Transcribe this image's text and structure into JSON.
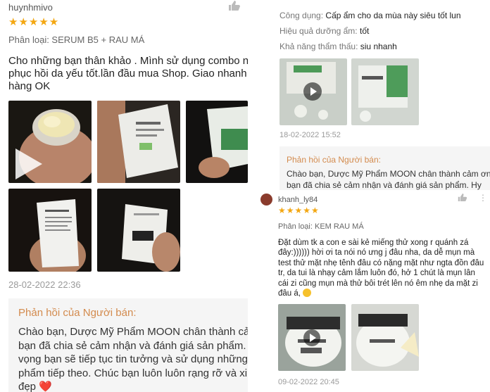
{
  "left_review": {
    "username": "huynhmivo",
    "stars": "★★★★★",
    "classification": "Phân loại: SERUM B5 + RAU MÁ",
    "comment_lines": [
      "Cho những bạn thân khảo . Mình sử dụng combo này",
      "phục hồi da yếu tốt.lần đầu mua Shop. Giao nhanh gọ",
      "hàng OK"
    ],
    "date": "28-02-2022 22:36",
    "seller_reply": {
      "title": "Phản hồi của Người bán:",
      "lines": [
        "Chào bạn, Dược Mỹ Phẩm MOON chân thành cảm ơ",
        "bạn đã chia sẻ cảm nhận và đánh giá sản phẩm. Hy",
        "vọng bạn sẽ tiếp tục tin tưởng và sử dụng những sả",
        "phẩm tiếp theo. Chúc bạn luôn luôn rạng rỡ và xinh",
        "đẹp ❤️"
      ]
    }
  },
  "right_review_1": {
    "attributes": [
      {
        "label": "Công dụng:",
        "value": "Cấp ẩm cho da mùa này siêu tốt lun"
      },
      {
        "label": "Hiệu quả dưỡng ẩm:",
        "value": "tốt"
      },
      {
        "label": "Khả năng thẩm thấu:",
        "value": "siu nhanh"
      }
    ],
    "date": "18-02-2022 15:52",
    "seller_reply": {
      "title": "Phản hồi của Người bán:",
      "lines": [
        "Chào bạn, Dược Mỹ Phẩm MOON chân thành cảm ơn",
        "bạn đã chia sẻ cảm nhận và đánh giá sản phẩm. Hy"
      ]
    }
  },
  "right_review_2": {
    "username": "khanh_ly84",
    "stars": "★★★★★",
    "classification": "Phân loại: KEM RAU MÁ",
    "comment_lines": [
      "Đặt dùm tk a con e sài kẻ miếng thử xong r quánh zá",
      "đây:)))))) hời ơi ta nói nó ưng j đâu nha, da dễ mụn mà",
      "test thử mặt nhẹ tênh đâu có nặng mặt như ngta đồn đâu",
      "tr, da tui là nhạy cảm lắm luôn đó, hở 1 chút là mụn lân",
      "cái zi cũng mụn mà thử bôi trét lên nó êm nhẹ da mặt zi",
      "đâu á,"
    ],
    "date": "09-02-2022 20:45"
  },
  "icons": {
    "like": "thumbs-up-icon",
    "play": "play-icon",
    "menu": "more-icon",
    "heart": "heart-emoji",
    "smile": "smile-emoji"
  },
  "colors": {
    "stars": "#f3a712",
    "reply_title": "#d38b4e",
    "reply_bg": "#f5f5f5",
    "date": "#9a9a9a"
  }
}
